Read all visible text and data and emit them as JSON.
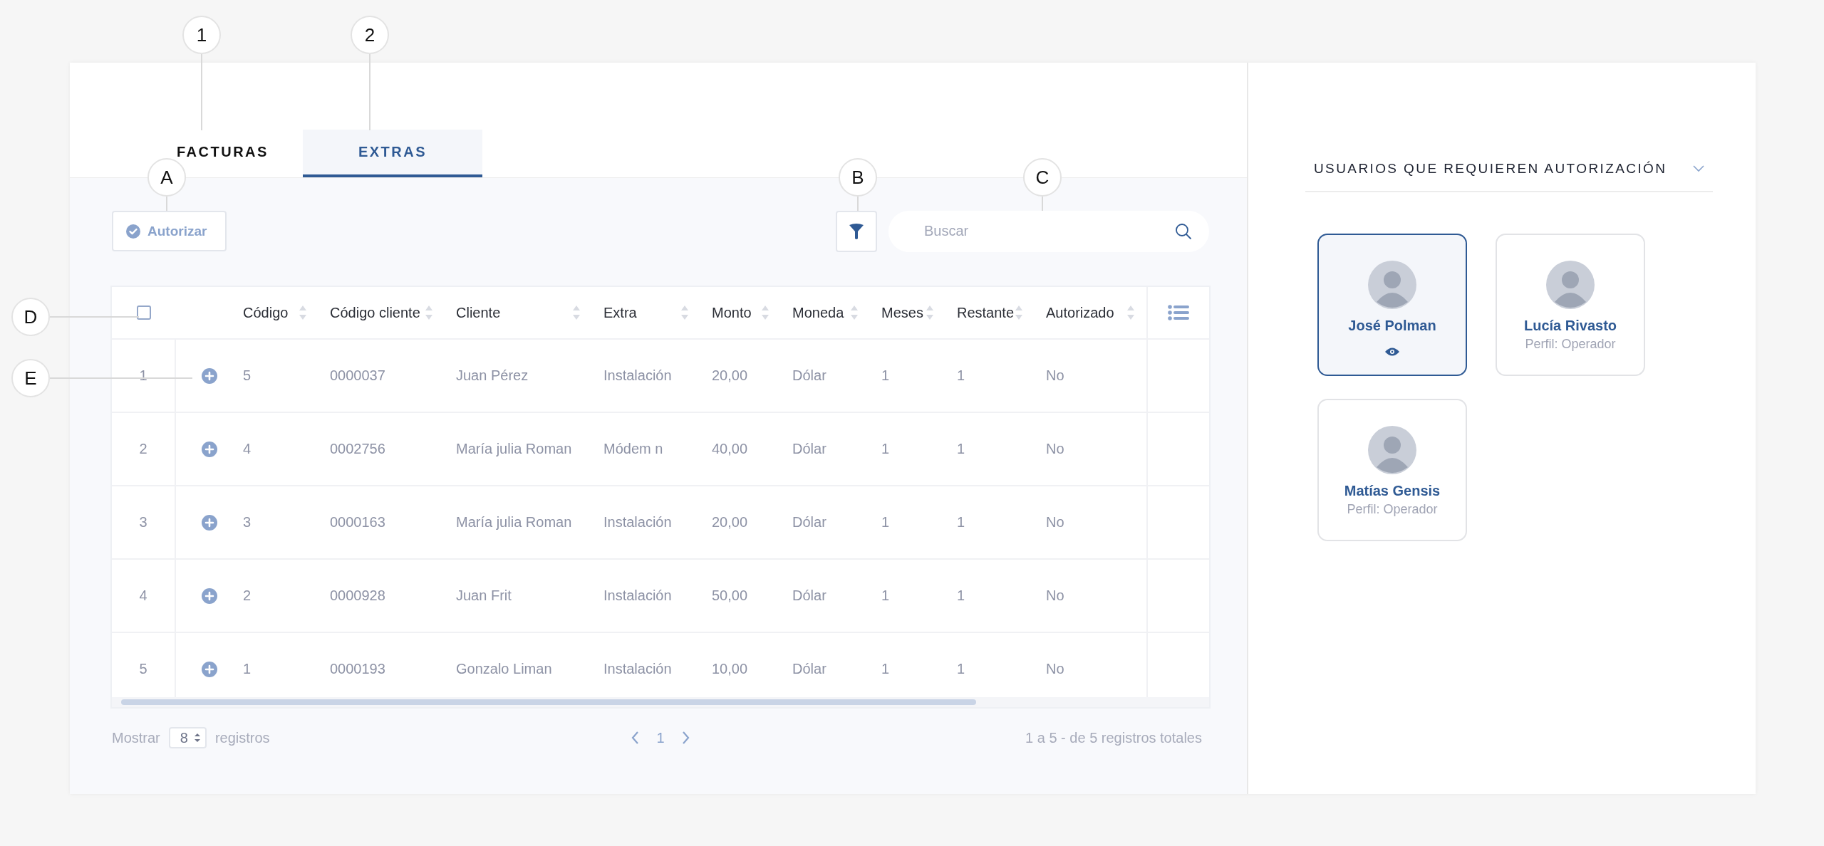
{
  "annotations": [
    {
      "label": "1"
    },
    {
      "label": "2"
    },
    {
      "label": "A"
    },
    {
      "label": "B"
    },
    {
      "label": "C"
    },
    {
      "label": "D"
    },
    {
      "label": "E"
    }
  ],
  "tabs": [
    {
      "label": "FACTURAS",
      "selected": false
    },
    {
      "label": "EXTRAS",
      "selected": true
    }
  ],
  "toolbar": {
    "authorize_button": "Autorizar",
    "search": {
      "placeholder": "Buscar"
    }
  },
  "table": {
    "select_all": {
      "checked": false
    },
    "columns": [
      {
        "label": "Código"
      },
      {
        "label": "Código cliente"
      },
      {
        "label": "Cliente"
      },
      {
        "label": "Extra"
      },
      {
        "label": "Monto"
      },
      {
        "label": "Moneda"
      },
      {
        "label": "Meses"
      },
      {
        "label": "Restante"
      },
      {
        "label": "Autorizado"
      }
    ],
    "rows": [
      {
        "number": "1",
        "cells": [
          "5",
          "0000037",
          "Juan Pérez",
          "Instalación",
          "20,00",
          "Dólar",
          "1",
          "1",
          "No"
        ]
      },
      {
        "number": "2",
        "cells": [
          "4",
          "0002756",
          "María julia Roman",
          "Módem n",
          "40,00",
          "Dólar",
          "1",
          "1",
          "No"
        ]
      },
      {
        "number": "3",
        "cells": [
          "3",
          "0000163",
          "María julia Roman",
          "Instalación",
          "20,00",
          "Dólar",
          "1",
          "1",
          "No"
        ]
      },
      {
        "number": "4",
        "cells": [
          "2",
          "0000928",
          "Juan Frit",
          "Instalación",
          "50,00",
          "Dólar",
          "1",
          "1",
          "No"
        ]
      },
      {
        "number": "5",
        "cells": [
          "1",
          "0000193",
          "Gonzalo Liman",
          "Instalación",
          "10,00",
          "Dólar",
          "1",
          "1",
          "No"
        ]
      }
    ]
  },
  "pagination": {
    "show_label": "Mostrar",
    "page_size": "8",
    "records_label": "registros",
    "pages": [
      {
        "label": "1",
        "selected": true
      }
    ],
    "summary": "1 a 5 - de 5 registros totales"
  },
  "users_panel": {
    "title": "USUARIOS QUE REQUIEREN AUTORIZACIÓN",
    "users": [
      {
        "name": "José Polman",
        "selected": true
      },
      {
        "name": "Lucía Rivasto",
        "profile": "Perfil: Operador",
        "selected": false
      },
      {
        "name": "Matías Gensis",
        "profile": "Perfil: Operador",
        "selected": false
      }
    ]
  }
}
